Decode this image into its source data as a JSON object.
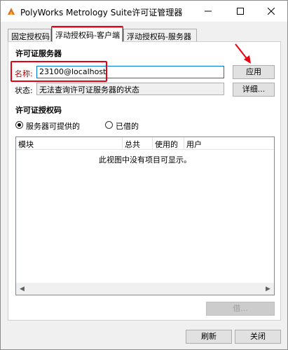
{
  "window": {
    "title": "PolyWorks Metrology Suite许可证管理器",
    "icon": "polyworks-logo-icon",
    "controls": {
      "minimize": "minimize-icon",
      "maximize": "maximize-icon",
      "close": "close-icon"
    }
  },
  "tabs": [
    {
      "label": "固定授权码",
      "active": false
    },
    {
      "label": "浮动授权码-客户端",
      "active": true
    },
    {
      "label": "浮动授权码-服务器",
      "active": false
    }
  ],
  "server_section": {
    "title": "许可证服务器",
    "name_label": "名称:",
    "name_value": "23100@localhost",
    "apply_button": "应用",
    "status_label": "状态:",
    "status_value": "无法查询许可证服务器的状态",
    "details_button": "详细..."
  },
  "license_section": {
    "title": "许可证授权码",
    "radio_options": [
      {
        "label": "服务器可提供的",
        "checked": true
      },
      {
        "label": "已借的",
        "checked": false
      }
    ],
    "columns": [
      "模块",
      "总共",
      "使用的",
      "用户"
    ],
    "empty_message": "此视图中没有项目可显示。",
    "borrow_button": "借..."
  },
  "footer": {
    "refresh_button": "刷新",
    "close_button": "关闭"
  },
  "colors": {
    "highlight": "#e60012",
    "focus_border": "#0078d7"
  }
}
